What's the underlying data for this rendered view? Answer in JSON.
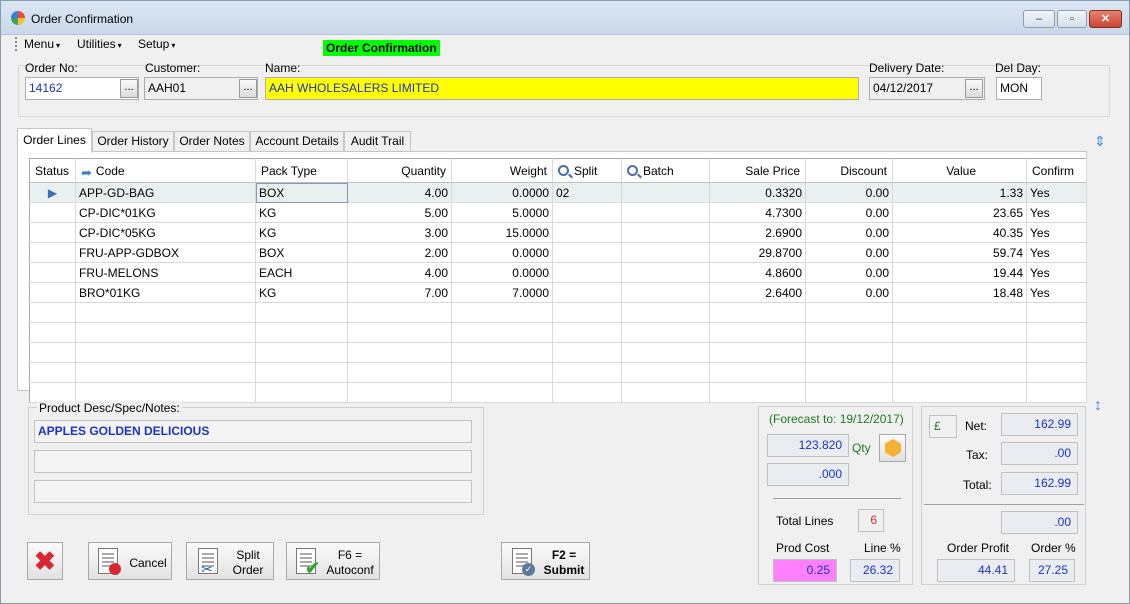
{
  "window": {
    "title": "Order Confirmation",
    "min_glyph": "–",
    "max_glyph": "▫",
    "close_glyph": "✕"
  },
  "menubar": {
    "items": [
      "Menu",
      "Utilities",
      "Setup"
    ],
    "caret": "▾"
  },
  "page_tag": "Order Confirmation",
  "header": {
    "order_no_label": "Order No:",
    "order_no": "14162",
    "customer_label": "Customer:",
    "customer": "AAH01",
    "name_label": "Name:",
    "name": "AAH  WHOLESALERS LIMITED",
    "delivery_date_label": "Delivery Date:",
    "delivery_date": "04/12/2017",
    "del_day_label": "Del Day:",
    "del_day": "MON",
    "browse_label": "..."
  },
  "tabs": [
    "Order Lines",
    "Order History",
    "Order Notes",
    "Account Details",
    "Audit Trail"
  ],
  "grid": {
    "columns": [
      "Status",
      "Code",
      "Pack Type",
      "Quantity",
      "Weight",
      "Split",
      "Batch",
      "Sale Price",
      "Discount",
      "Value",
      "Confirm"
    ],
    "rows": [
      {
        "status": "▶",
        "code": "APP-GD-BAG",
        "pack": "BOX",
        "qty": "4.00",
        "weight": "0.0000",
        "split": "02",
        "batch": "",
        "price": "0.3320",
        "discount": "0.00",
        "value": "1.33",
        "confirm": "Yes"
      },
      {
        "status": "",
        "code": "CP-DIC*01KG",
        "pack": "KG",
        "qty": "5.00",
        "weight": "5.0000",
        "split": "",
        "batch": "",
        "price": "4.7300",
        "discount": "0.00",
        "value": "23.65",
        "confirm": "Yes"
      },
      {
        "status": "",
        "code": "CP-DIC*05KG",
        "pack": "KG",
        "qty": "3.00",
        "weight": "15.0000",
        "split": "",
        "batch": "",
        "price": "2.6900",
        "discount": "0.00",
        "value": "40.35",
        "confirm": "Yes"
      },
      {
        "status": "",
        "code": "FRU-APP-GDBOX",
        "pack": "BOX",
        "qty": "2.00",
        "weight": "0.0000",
        "split": "",
        "batch": "",
        "price": "29.8700",
        "discount": "0.00",
        "value": "59.74",
        "confirm": "Yes"
      },
      {
        "status": "",
        "code": "FRU-MELONS",
        "pack": "EACH",
        "qty": "4.00",
        "weight": "0.0000",
        "split": "",
        "batch": "",
        "price": "4.8600",
        "discount": "0.00",
        "value": "19.44",
        "confirm": "Yes"
      },
      {
        "status": "",
        "code": "BRO*01KG",
        "pack": "KG",
        "qty": "7.00",
        "weight": "7.0000",
        "split": "",
        "batch": "",
        "price": "2.6400",
        "discount": "0.00",
        "value": "18.48",
        "confirm": "Yes"
      }
    ],
    "empty_rows": 5
  },
  "product_desc": {
    "label": "Product Desc/Spec/Notes:",
    "line1": "APPLES GOLDEN DELICIOUS",
    "line2": "",
    "line3": ""
  },
  "buttons": {
    "cancel": "Cancel",
    "split_order_1": "Split",
    "split_order_2": "Order",
    "autoconf_1": "F6 =",
    "autoconf_2": "Autoconf",
    "submit_1": "F2 =",
    "submit_2": "Submit"
  },
  "forecast": {
    "label": "(Forecast to: 19/12/2017)",
    "value1": "123.820",
    "qty_label": "Qty",
    "value2": ".000",
    "total_lines_label": "Total Lines",
    "total_lines": "6",
    "prod_cost_label": "Prod Cost",
    "prod_cost": "0.25",
    "line_pct_label": "Line %",
    "line_pct": "26.32"
  },
  "totals": {
    "currency": "£",
    "net_label": "Net:",
    "net": "162.99",
    "tax_label": "Tax:",
    "tax": ".00",
    "total_label": "Total:",
    "total": "162.99",
    "extra": ".00",
    "order_profit_label": "Order Profit",
    "order_profit": "44.41",
    "order_pct_label": "Order %",
    "order_pct": "27.25"
  },
  "colors": {
    "name_highlight": "#ffff00",
    "page_tag": "#00ff00",
    "prod_cost_bg": "#ff80ff",
    "value_text": "#1a33c8",
    "forecast_text": "#1f7a1f"
  }
}
